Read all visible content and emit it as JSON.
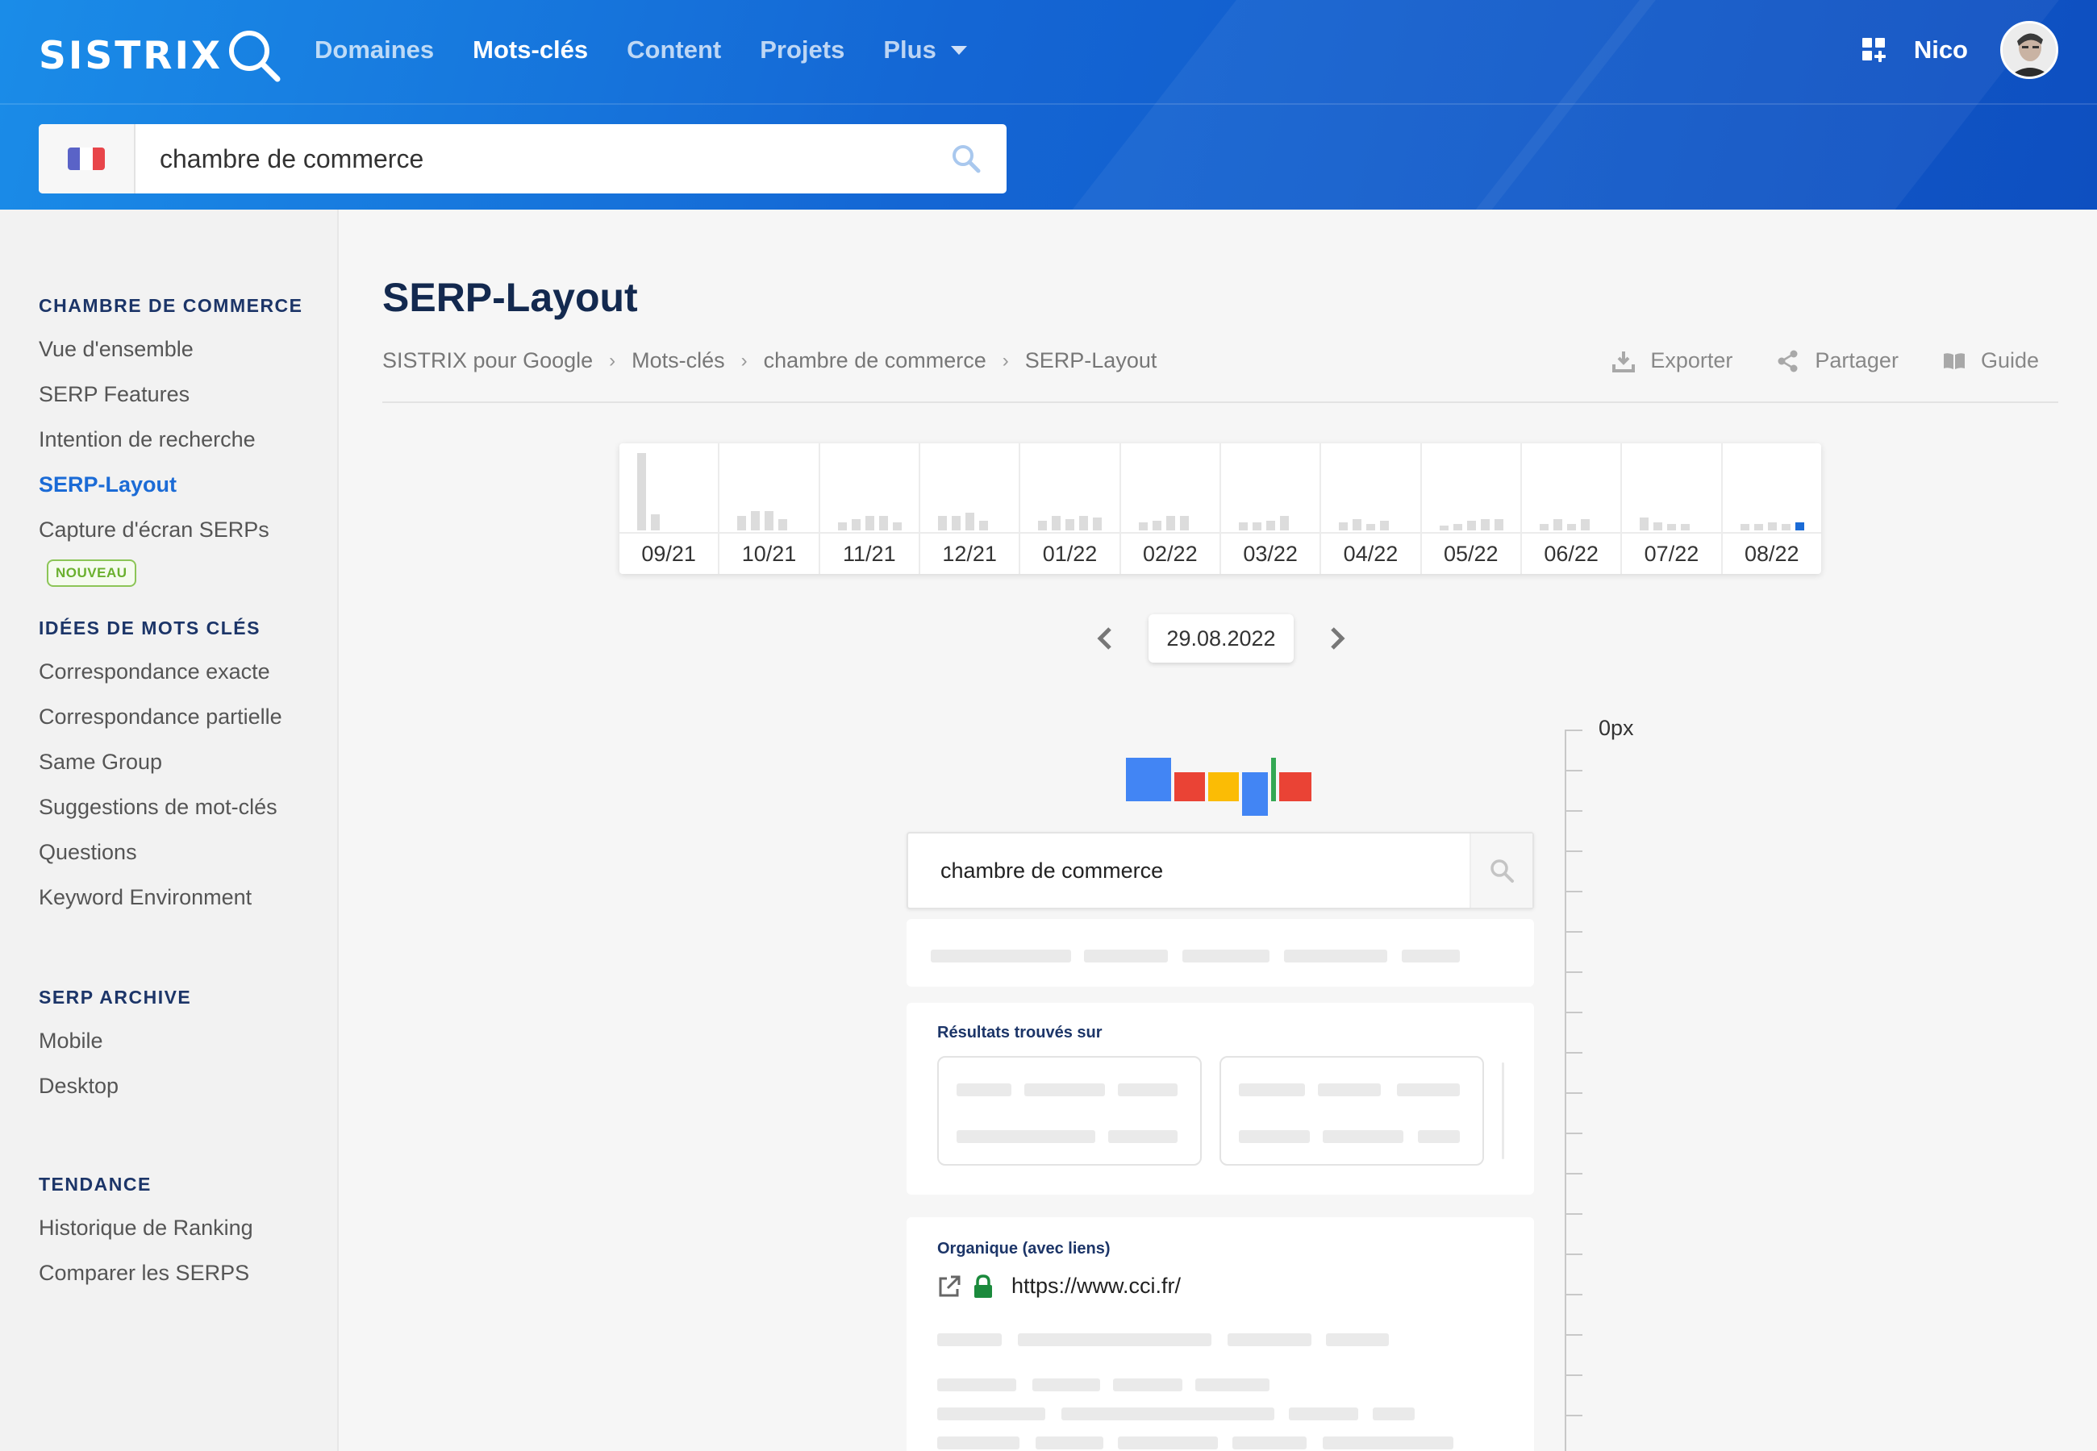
{
  "brand": {
    "name": "SISTRIX",
    "primary": "#1466d4",
    "accent": "#1b6bd6"
  },
  "nav": {
    "items": [
      {
        "label": "Domaines",
        "active": false
      },
      {
        "label": "Mots-clés",
        "active": true
      },
      {
        "label": "Content",
        "active": false
      },
      {
        "label": "Projets",
        "active": false
      },
      {
        "label": "Plus",
        "active": false
      }
    ],
    "user_name": "Nico"
  },
  "search": {
    "country": "France",
    "value": "chambre de commerce",
    "icon": "search-icon"
  },
  "sidebar": {
    "sections": [
      {
        "heading": "CHAMBRE DE COMMERCE",
        "items": [
          "Vue d'ensemble",
          "SERP Features",
          "Intention de recherche",
          "SERP-Layout",
          "Capture d'écran SERPs"
        ],
        "active": "SERP-Layout",
        "badge": "NOUVEAU"
      },
      {
        "heading": "IDÉES DE MOTS CLÉS",
        "items": [
          "Correspondance exacte",
          "Correspondance partielle",
          "Same Group",
          "Suggestions de mot-clés",
          "Questions",
          "Keyword Environment"
        ]
      },
      {
        "heading": "SERP ARCHIVE",
        "items": [
          "Mobile",
          "Desktop"
        ]
      },
      {
        "heading": "TENDANCE",
        "items": [
          "Historique de Ranking",
          "Comparer les SERPS"
        ]
      }
    ]
  },
  "page": {
    "title": "SERP-Layout",
    "breadcrumb": [
      "SISTRIX pour Google",
      "Mots-clés",
      "chambre de commerce",
      "SERP-Layout"
    ],
    "actions": {
      "export": "Exporter",
      "share": "Partager",
      "guide": "Guide"
    }
  },
  "timeline": {
    "months": [
      "09/21",
      "10/21",
      "11/21",
      "12/21",
      "01/22",
      "02/22",
      "03/22",
      "04/22",
      "05/22",
      "06/22",
      "07/22",
      "08/22"
    ],
    "selected_month": "08/22",
    "selected_color": "#1b6bd6"
  },
  "date_nav": {
    "current": "29.08.2022"
  },
  "serp_preview": {
    "ruler_label": "0px",
    "query": "chambre de commerce",
    "sections": {
      "found_on": "Résultats trouvés sur",
      "organic": "Organique (avec liens)",
      "organic_url": "https://www.cci.fr/"
    },
    "google_colors": [
      "#4285f4",
      "#ea4335",
      "#fbbc05",
      "#4285f4",
      "#34a853",
      "#ea4335"
    ]
  }
}
